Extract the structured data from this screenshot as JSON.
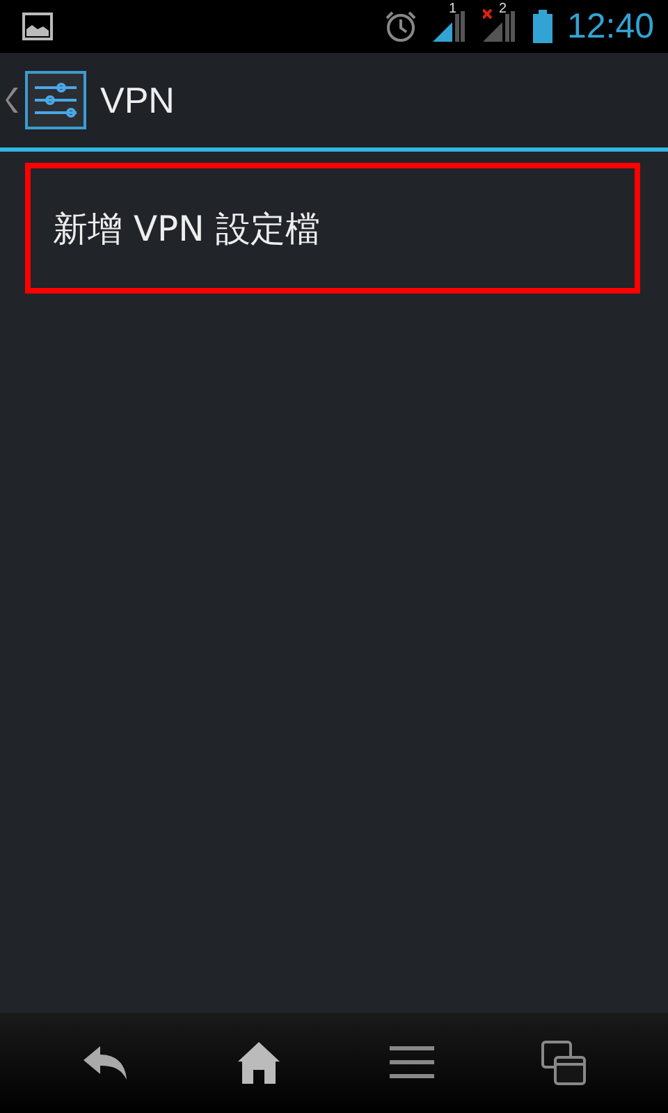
{
  "status_bar": {
    "sim_labels": [
      "1",
      "2"
    ],
    "time": "12:40"
  },
  "action_bar": {
    "title": "VPN"
  },
  "list": [
    {
      "label": "新增 VPN 設定檔",
      "highlighted": true
    }
  ]
}
